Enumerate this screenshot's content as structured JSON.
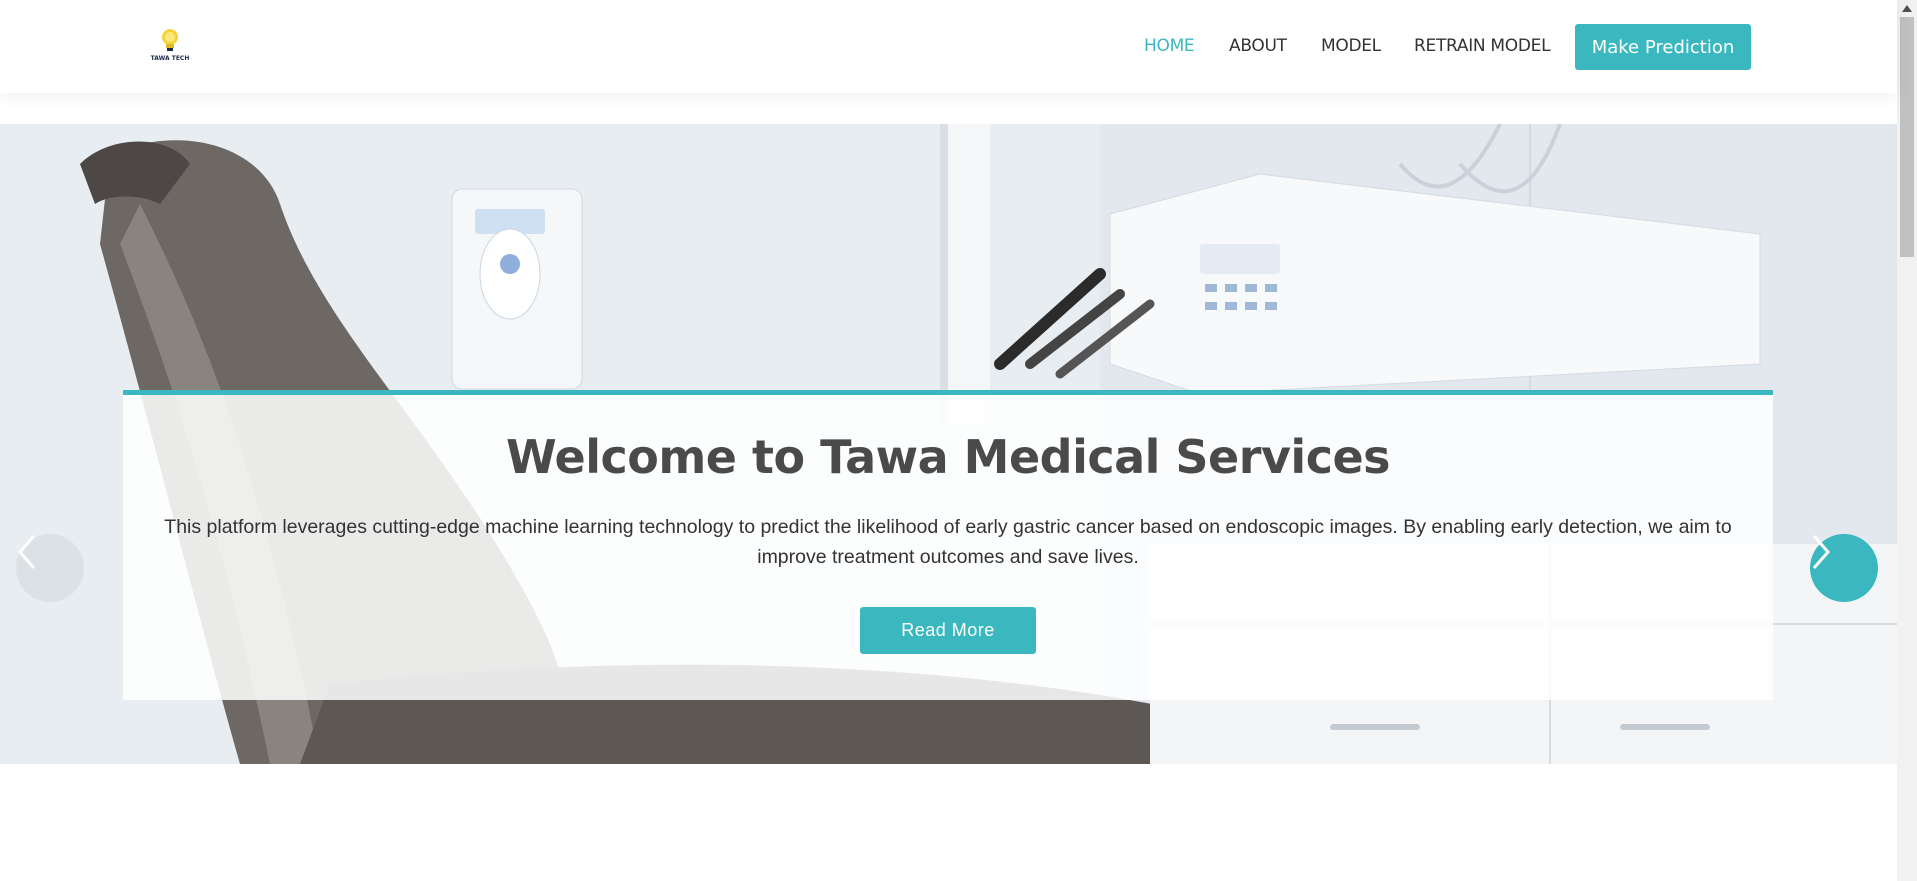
{
  "brand": {
    "logo_text": "TAWA TECH",
    "logo_icon": "lightbulb-icon"
  },
  "nav": {
    "items": [
      {
        "label": "HOME",
        "active": true
      },
      {
        "label": "ABOUT",
        "active": false
      },
      {
        "label": "MODEL",
        "active": false
      },
      {
        "label": "RETRAIN MODEL",
        "active": false
      }
    ],
    "cta_label": "Make Prediction"
  },
  "hero": {
    "title": "Welcome to Tawa Medical Services",
    "description": "This platform leverages cutting-edge machine learning technology to predict the likelihood of early gastric cancer based on endoscopic images. By enabling early detection, we aim to improve treatment outcomes and save lives.",
    "button_label": "Read More",
    "slides": {
      "count": 3,
      "active_index": 0
    },
    "prev_icon": "chevron-left-icon",
    "next_icon": "chevron-right-icon"
  },
  "colors": {
    "accent": "#3bb8bf",
    "heading": "#4a4a4a",
    "text": "#333333"
  }
}
